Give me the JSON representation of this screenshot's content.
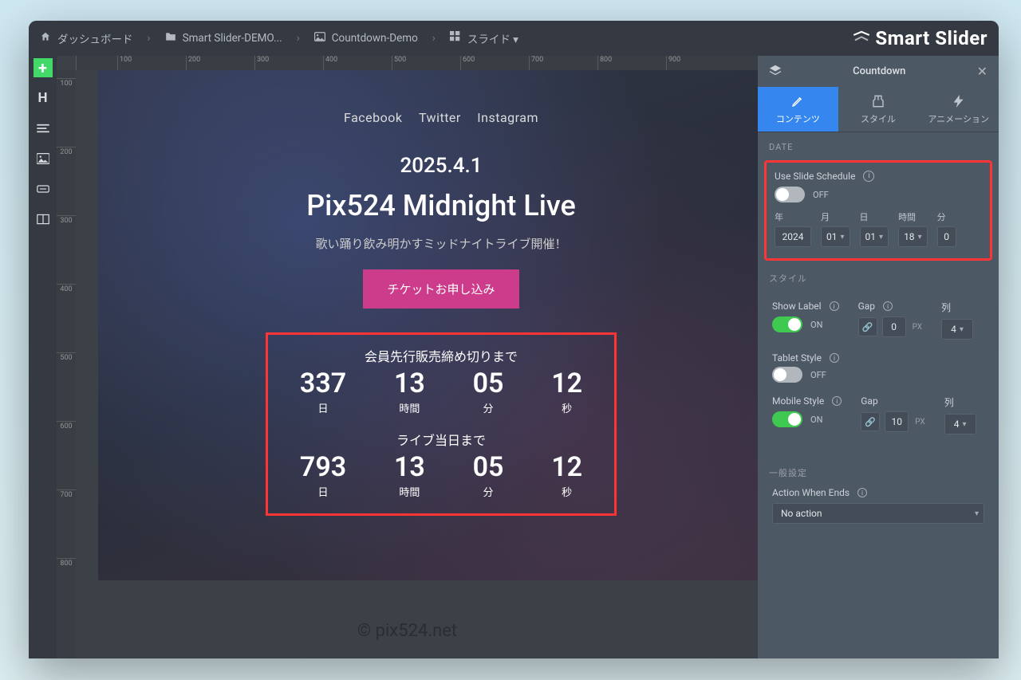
{
  "breadcrumb": {
    "dashboard": "ダッシュボード",
    "slider": "Smart Slider-DEMO...",
    "slide": "Countdown-Demo",
    "slides_dropdown": "スライド"
  },
  "logo_text": "Smart Slider",
  "ruler_h": [
    "100",
    "200",
    "300",
    "400",
    "500",
    "600",
    "700",
    "800",
    "900"
  ],
  "ruler_v": [
    "100",
    "200",
    "300",
    "400",
    "500",
    "600",
    "700",
    "800"
  ],
  "slide": {
    "socials": [
      "Facebook",
      "Twitter",
      "Instagram"
    ],
    "date": "2025.4.1",
    "title": "Pix524 Midnight Live",
    "subtitle": "歌い踊り飲み明かすミッドナイトライブ開催！",
    "cta": "チケットお申し込み",
    "cd1_title": "会員先行販売締め切りまで",
    "cd2_title": "ライブ当日まで",
    "labels": {
      "d": "日",
      "h": "時間",
      "m": "分",
      "s": "秒"
    },
    "cd1": {
      "d": "337",
      "h": "13",
      "m": "05",
      "s": "12"
    },
    "cd2": {
      "d": "793",
      "h": "13",
      "m": "05",
      "s": "12"
    }
  },
  "watermark": "© pix524.net",
  "panel": {
    "title": "Countdown",
    "tab_content": "コンテンツ",
    "tab_style": "スタイル",
    "tab_anim": "アニメーション",
    "section_date": "DATE",
    "use_schedule": "Use Slide Schedule",
    "use_schedule_state": "OFF",
    "date_labels": {
      "year": "年",
      "month": "月",
      "day": "日",
      "hour": "時間",
      "minute": "分"
    },
    "date_values": {
      "year": "2024",
      "month": "01",
      "day": "01",
      "hour": "18",
      "minute": "0"
    },
    "section_style": "スタイル",
    "show_label": "Show Label",
    "show_label_state": "ON",
    "gap": "Gap",
    "gap_value": "0",
    "col_label": "列",
    "col_value": "4",
    "tablet_style": "Tablet Style",
    "tablet_state": "OFF",
    "mobile_style": "Mobile Style",
    "mobile_state": "ON",
    "gap_mobile": "10",
    "col_mobile": "4",
    "section_general": "一般設定",
    "action_ends": "Action When Ends",
    "action_value": "No action"
  }
}
